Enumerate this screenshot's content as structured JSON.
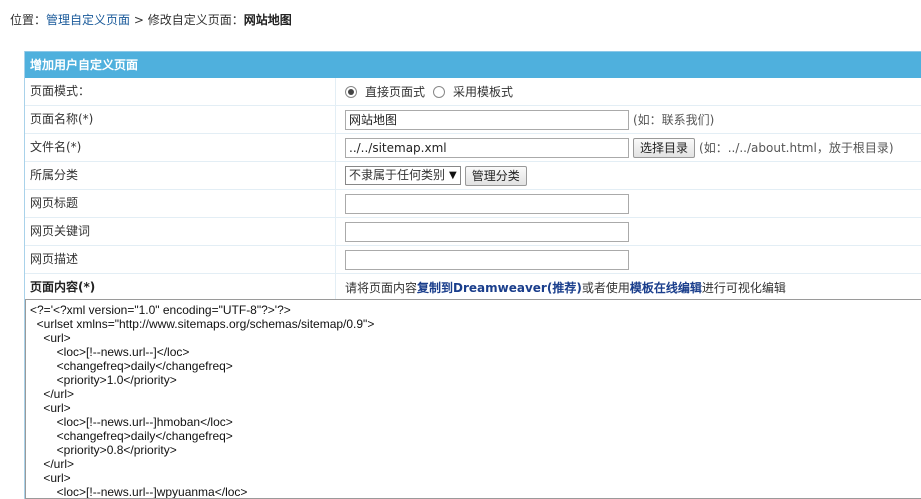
{
  "breadcrumb": {
    "prefix": "位置：",
    "link1": "管理自定义页面",
    "sep": " > ",
    "middle": "修改自定义页面：",
    "current": "网站地图"
  },
  "panel": {
    "title": "增加用户自定义页面"
  },
  "form": {
    "mode": {
      "label": "页面模式：",
      "options": [
        "直接页面式",
        "采用模板式"
      ],
      "selected": 0
    },
    "name": {
      "label": "页面名称(*)",
      "value": "网站地图",
      "hint": "(如：联系我们)"
    },
    "filename": {
      "label": "文件名(*)",
      "value": "../../sitemap.xml",
      "button": "选择目录",
      "hint": "(如：../../about.html，放于根目录)"
    },
    "category": {
      "label": "所属分类",
      "selected": "不隶属于任何类别",
      "button": "管理分类"
    },
    "page_title": {
      "label": "网页标题",
      "value": ""
    },
    "keywords": {
      "label": "网页关键词",
      "value": ""
    },
    "description": {
      "label": "网页描述",
      "value": ""
    },
    "content": {
      "label": "页面内容(*)",
      "text1": "请将页面内容",
      "link1": "复制到Dreamweaver(推荐)",
      "text2": "或者使用",
      "link2": "模板在线编辑",
      "text3": "进行可视化编辑"
    }
  },
  "editor": {
    "content": "<?='<?xml version=\"1.0\" encoding=\"UTF-8\"?>'?>\n  <urlset xmlns=\"http://www.sitemaps.org/schemas/sitemap/0.9\">\n    <url>\n        <loc>[!--news.url--]</loc>\n        <changefreq>daily</changefreq>\n        <priority>1.0</priority>\n    </url>\n    <url>\n        <loc>[!--news.url--]hmoban</loc>\n        <changefreq>daily</changefreq>\n        <priority>0.8</priority>\n    </url>\n    <url>\n        <loc>[!--news.url--]wpyuanma</loc>"
  }
}
